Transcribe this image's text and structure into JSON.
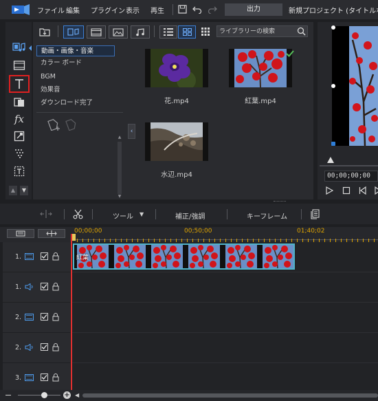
{
  "menu": {
    "items": [
      "ファイル",
      "編集",
      "プラグイン",
      "表示",
      "再生"
    ],
    "output_label": "出力",
    "project_title": "新規プロジェクト (タイトルなし)*"
  },
  "library": {
    "search_placeholder": "ライブラリーの検索",
    "categories": [
      "動画・画像・音楽",
      "カラー ボード",
      "BGM",
      "効果音",
      "ダウンロード完了"
    ],
    "selected_category": 0,
    "media": [
      {
        "name": "花.mp4",
        "checked": false
      },
      {
        "name": "紅葉.mp4",
        "checked": true
      },
      {
        "name": "水辺.mp4",
        "checked": false
      }
    ]
  },
  "preview": {
    "timecode": "00;00;00;00"
  },
  "edit_toolbar": {
    "tools_label": "ツール",
    "correct_label": "補正/強調",
    "keyframe_label": "キーフレーム"
  },
  "timeline": {
    "ruler": [
      "00;00;00",
      "00;50;00",
      "01;40;02"
    ],
    "clip_label": "紅葉",
    "tracks": [
      {
        "label": "1.",
        "type": "video"
      },
      {
        "label": "1.",
        "type": "audio"
      },
      {
        "label": "2.",
        "type": "video"
      },
      {
        "label": "2.",
        "type": "audio"
      },
      {
        "label": "3.",
        "type": "video"
      }
    ]
  },
  "colors": {
    "accent": "#3b7fd6",
    "highlight": "#e02020",
    "playhead": "#e03030",
    "clip_border": "#4fb3c9",
    "check": "#57c15a"
  }
}
